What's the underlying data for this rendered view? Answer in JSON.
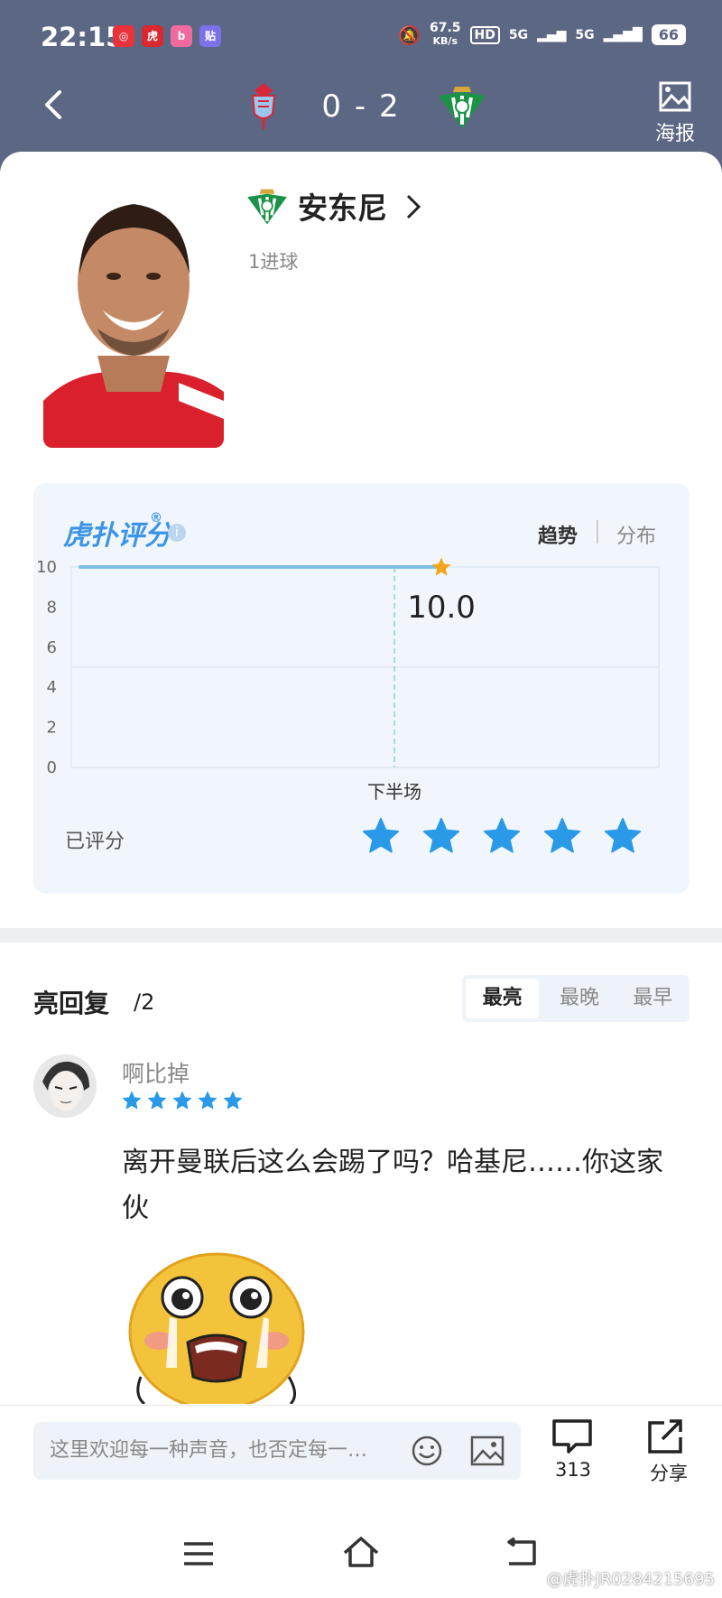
{
  "status_bar": {
    "time": "22:15",
    "net_speed_value": "67.5",
    "net_speed_unit": "KB/s",
    "battery": "66",
    "signal_1": "5G",
    "signal_2": "5G",
    "hd": "HD",
    "app_icons": [
      "app-icon-1",
      "app-icon-2",
      "app-icon-3",
      "app-icon-4"
    ]
  },
  "match_header": {
    "score": "0 - 2",
    "poster_label": "海报"
  },
  "player": {
    "name": "安东尼",
    "stat": "1进球"
  },
  "rating_panel": {
    "logo_text": "虎扑评分",
    "tab_trend": "趋势",
    "tab_distribution": "分布",
    "rated_label": "已评分",
    "user_stars": 5,
    "star_color": "#2a9ae8"
  },
  "chart_data": {
    "type": "line",
    "x": [
      "下半场"
    ],
    "series": [
      {
        "values": [
          10.0
        ]
      }
    ],
    "data_label": "10.0",
    "y_ticks": [
      "10",
      "8",
      "6",
      "4",
      "2",
      "0"
    ],
    "ylim": [
      0,
      10
    ],
    "grid": true,
    "line_color": "#7cc0e4",
    "marker_color": "#f2a51a"
  },
  "replies": {
    "title": "亮回复",
    "count": "/2",
    "sort_options": [
      "最亮",
      "最晚",
      "最早"
    ],
    "selected_sort": "最亮",
    "items": [
      {
        "username": "啊比掉",
        "stars": 5,
        "text": "离开曼联后这么会踢了吗？哈基尼……你这家伙"
      }
    ]
  },
  "bottom_bar": {
    "input_placeholder": "这里欢迎每一种声音，也否定每一…",
    "comment_count": "313",
    "share_label": "分享"
  },
  "watermark": "@虎扑JR0284215695",
  "colors": {
    "header_bg": "#5c6784",
    "accent": "#2a9ae8",
    "panel_bg": "#f1f6fc"
  }
}
